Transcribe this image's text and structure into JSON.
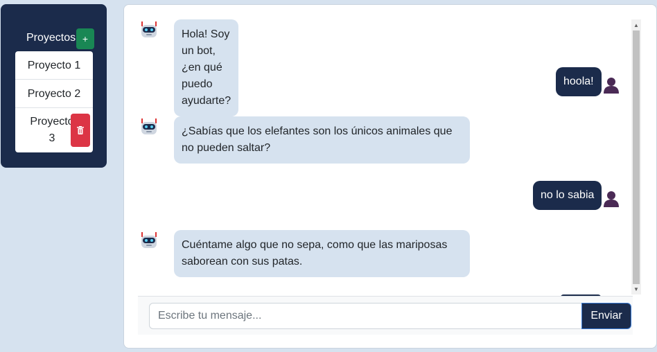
{
  "sidebar": {
    "title": "Proyectos",
    "add_label": "+",
    "projects": [
      {
        "label": "Proyecto 1"
      },
      {
        "label": "Proyecto 2"
      },
      {
        "label": "Proyecto 3"
      }
    ]
  },
  "chat": {
    "messages": [
      {
        "sender": "bot",
        "text": "Hola! Soy un bot, ¿en qué puedo ayudarte?"
      },
      {
        "sender": "user",
        "text": "hoola!"
      },
      {
        "sender": "bot",
        "text": "¿Sabías que los elefantes son los únicos animales que no pueden saltar?"
      },
      {
        "sender": "user",
        "text": "no lo sabia"
      },
      {
        "sender": "bot",
        "text": "Cuéntame algo que no sepa, como que las mariposas saborean con sus patas."
      }
    ],
    "input_placeholder": "Escribe tu mensaje...",
    "send_label": "Enviar"
  },
  "colors": {
    "background": "#d6e2ef",
    "navy": "#1b2b4b",
    "add_green": "#198754",
    "delete_red": "#dc3545",
    "bot_bubble": "#d6e2ef"
  },
  "icons": {
    "bot": "robot-icon",
    "user": "user-silhouette-icon",
    "delete": "trash-icon"
  }
}
